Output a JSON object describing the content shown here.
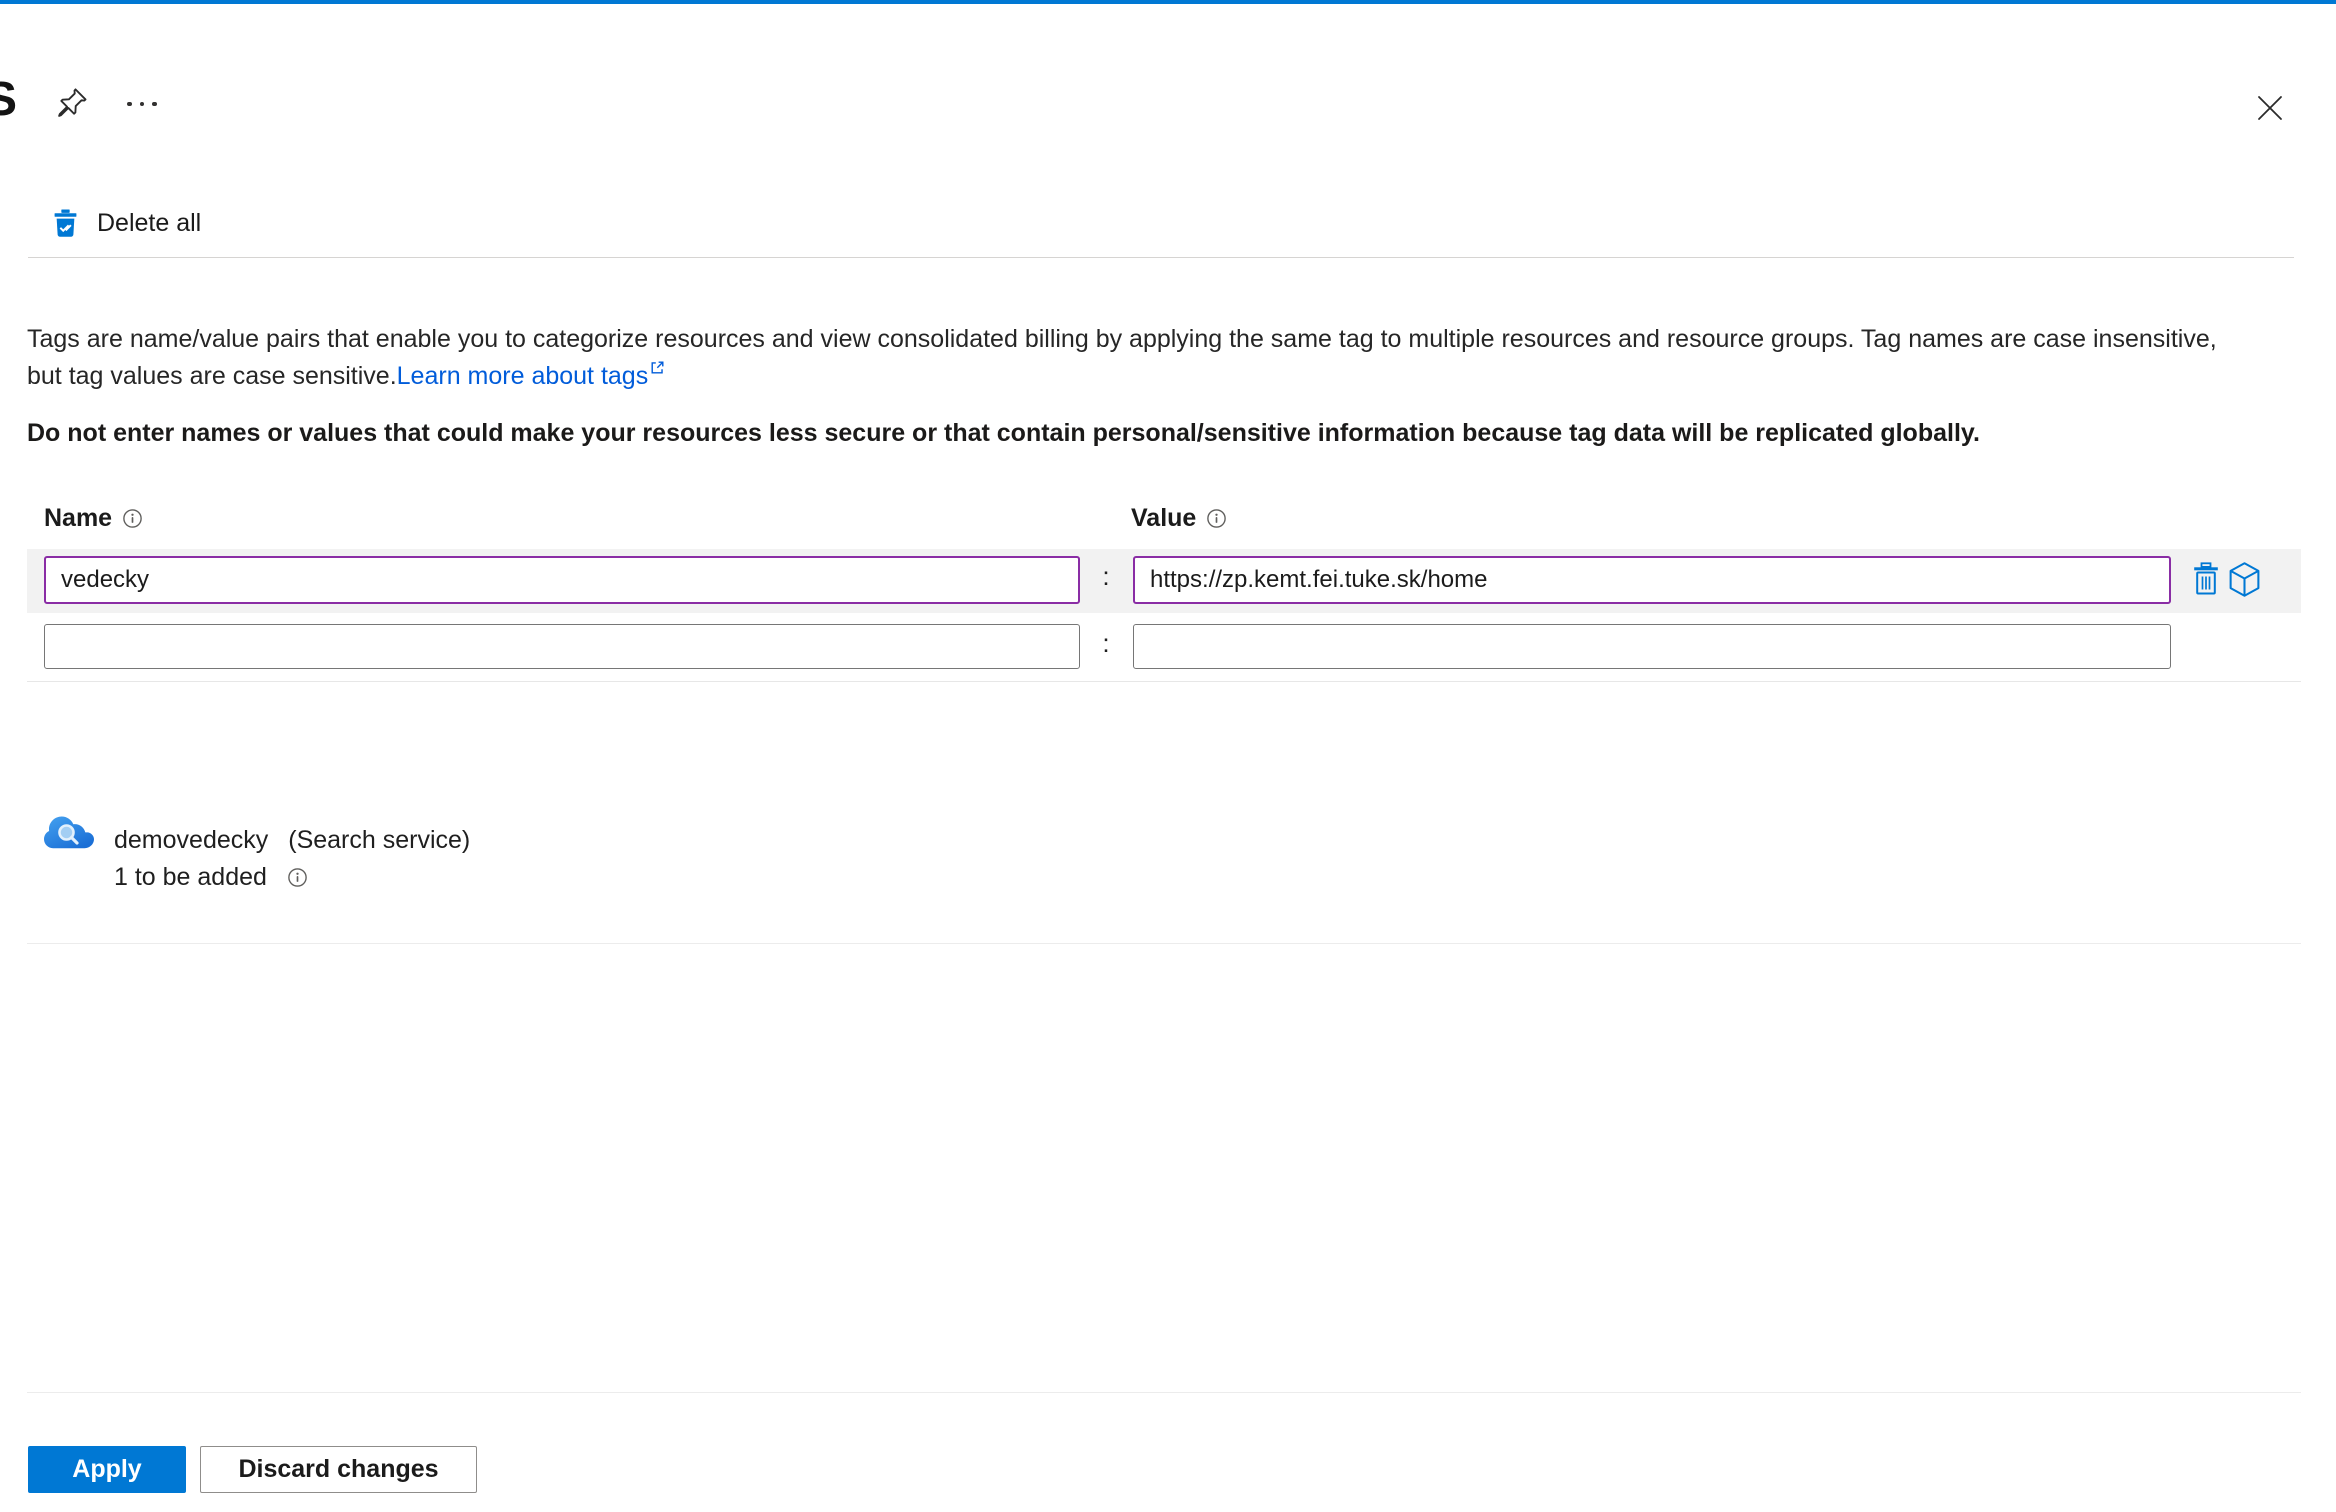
{
  "header": {
    "title_fragment": "S"
  },
  "toolbar": {
    "delete_all_label": "Delete all"
  },
  "intro": {
    "line1": "Tags are name/value pairs that enable you to categorize resources and view consolidated billing by applying the same tag to multiple resources and resource groups. Tag names are case insensitive,",
    "line2_prefix": "but tag values are case sensitive.",
    "link_label": "Learn more about tags",
    "warning": "Do not enter names or values that could make your resources less secure or that contain personal/sensitive information because tag data will be replicated globally."
  },
  "tags": {
    "name_header": "Name",
    "value_header": "Value",
    "separator": ":",
    "rows": [
      {
        "name": "vedecky",
        "value": "https://zp.kemt.fei.tuke.sk/home"
      },
      {
        "name": "",
        "value": ""
      }
    ]
  },
  "resource": {
    "name": "demovedecky",
    "type_label": "(Search service)",
    "pending_label": "1 to be added"
  },
  "footer": {
    "apply_label": "Apply",
    "discard_label": "Discard changes"
  },
  "icons": {
    "pin": "pushpin-outline",
    "more": "ellipsis-dots",
    "close": "x-cross",
    "delete_all": "blue-trash-with-checkmarks",
    "info": "circled-i",
    "external_link": "box-with-arrow",
    "delete_row": "blue-trash-outline",
    "cube": "blue-cube-outline",
    "search_service": "blue-cloud-with-magnifier"
  },
  "colors": {
    "accent": "#0078d4",
    "modified_border": "#8a2da5",
    "link": "#015cda",
    "row_highlight": "#f2f2f2"
  }
}
